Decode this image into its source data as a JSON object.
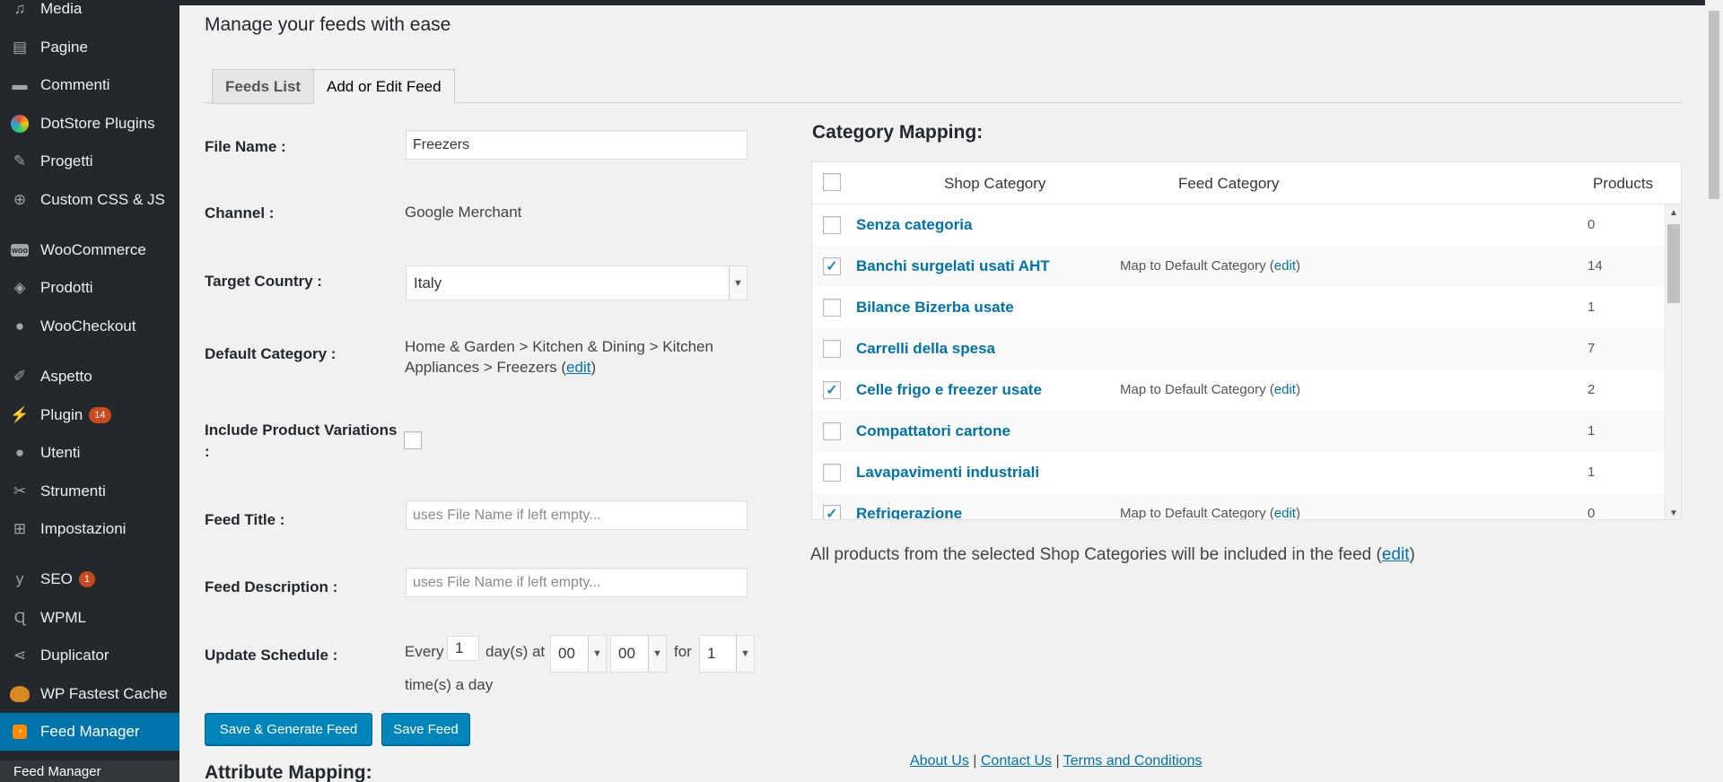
{
  "sidebar": {
    "items": [
      {
        "label": "Media",
        "icon": "media-icon"
      },
      {
        "label": "Pagine",
        "icon": "pages-icon"
      },
      {
        "label": "Commenti",
        "icon": "comments-icon"
      },
      {
        "label": "DotStore Plugins",
        "icon": "dotstore-icon"
      },
      {
        "label": "Progetti",
        "icon": "pin-icon"
      },
      {
        "label": "Custom CSS & JS",
        "icon": "plus-circle-icon"
      },
      {
        "label": "WooCommerce",
        "icon": "woocommerce-icon"
      },
      {
        "label": "Prodotti",
        "icon": "box-icon"
      },
      {
        "label": "WooCheckout",
        "icon": "user-icon"
      },
      {
        "label": "Aspetto",
        "icon": "brush-icon"
      },
      {
        "label": "Plugin",
        "icon": "plugin-icon",
        "badge": "14"
      },
      {
        "label": "Utenti",
        "icon": "users-icon"
      },
      {
        "label": "Strumenti",
        "icon": "wrench-icon"
      },
      {
        "label": "Impostazioni",
        "icon": "settings-icon"
      },
      {
        "label": "SEO",
        "icon": "yoast-icon",
        "badge": "1"
      },
      {
        "label": "WPML",
        "icon": "wpml-icon"
      },
      {
        "label": "Duplicator",
        "icon": "share-icon"
      },
      {
        "label": "WP Fastest Cache",
        "icon": "cheetah-icon"
      },
      {
        "label": "Feed Manager",
        "icon": "rss-icon"
      }
    ],
    "submenu_label": "Feed Manager"
  },
  "page": {
    "title": "Manage your feeds with ease",
    "tabs": [
      "Feeds List",
      "Add or Edit Feed"
    ]
  },
  "form": {
    "file_name_label": "File Name :",
    "file_name_value": "Freezers",
    "channel_label": "Channel :",
    "channel_value": "Google Merchant",
    "country_label": "Target Country :",
    "country_value": "Italy",
    "default_category_label": "Default Category :",
    "default_category_value": "Home & Garden > Kitchen & Dining > Kitchen Appliances > Freezers",
    "default_category_edit": "edit",
    "variations_label": "Include Product Variations :",
    "feed_title_label": "Feed Title :",
    "feed_title_placeholder": "uses File Name if left empty...",
    "feed_desc_label": "Feed Description :",
    "feed_desc_placeholder": "uses File Name if left empty...",
    "schedule_label": "Update Schedule :",
    "schedule_every": "Every",
    "schedule_days": "1",
    "schedule_days_at": "day(s) at",
    "schedule_hour": "00",
    "schedule_minute": "00",
    "schedule_for": "for",
    "schedule_times": "1",
    "schedule_times_suffix": "time(s) a day",
    "save_generate_label": "Save & Generate Feed",
    "save_label": "Save Feed"
  },
  "attribute_mapping_title": "Attribute Mapping:",
  "category_mapping": {
    "title": "Category Mapping:",
    "headers": {
      "shop": "Shop Category",
      "feed": "Feed Category",
      "products": "Products"
    },
    "rows": [
      {
        "name": "Senza categoria",
        "checked": false,
        "map": "",
        "count": "0"
      },
      {
        "name": "Banchi surgelati usati AHT",
        "checked": true,
        "map": "Map to Default Category",
        "count": "14"
      },
      {
        "name": "Bilance Bizerba usate",
        "checked": false,
        "map": "",
        "count": "1"
      },
      {
        "name": "Carrelli della spesa",
        "checked": false,
        "map": "",
        "count": "7"
      },
      {
        "name": "Celle frigo e freezer usate",
        "checked": true,
        "map": "Map to Default Category",
        "count": "2"
      },
      {
        "name": "Compattatori cartone",
        "checked": false,
        "map": "",
        "count": "1"
      },
      {
        "name": "Lavapavimenti industriali",
        "checked": false,
        "map": "",
        "count": "1"
      },
      {
        "name": "Refrigerazione",
        "checked": true,
        "map": "Map to Default Category",
        "count": "0"
      }
    ],
    "edit_label": "edit",
    "note_text": "All products from the selected Shop Categories will be included in the feed",
    "note_edit": "edit"
  },
  "footer": {
    "about": "About Us",
    "contact": "Contact Us",
    "terms": "Terms and Conditions",
    "separator": "|"
  },
  "colors": {
    "accent": "#0073aa",
    "button": "#0085ba",
    "sidebar": "#23282d",
    "badge": "#ca4a1f"
  }
}
